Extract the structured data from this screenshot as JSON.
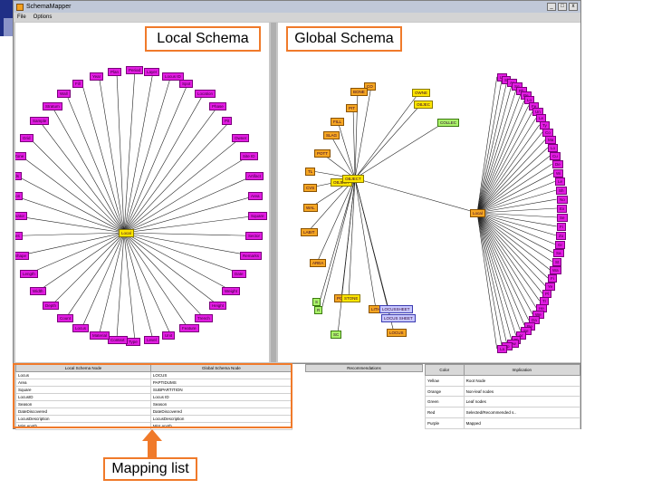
{
  "window": {
    "title": "SchemaMapper",
    "min": "_",
    "max": "□",
    "close": "x"
  },
  "menu": [
    "File",
    "Options"
  ],
  "callouts": {
    "local": "Local Schema",
    "global": "Global Schema",
    "mapping": "Mapping list"
  },
  "local_graph": {
    "center": "Local",
    "nodes": [
      "Period",
      "Layer",
      "Locus ID",
      "Spot",
      "Location",
      "Phase",
      "Pit",
      "Owner",
      "Site ID",
      "Artifact",
      "Area",
      "Square",
      "Sector",
      "Remarks",
      "Date",
      "Weight",
      "Height",
      "Trench",
      "Feature",
      "Unit",
      "Level",
      "Type",
      "Context",
      "Material",
      "Locus",
      "Count",
      "Depth",
      "Width",
      "Length",
      "Shape",
      "Notes",
      "Excavator",
      "Season",
      "Finds",
      "Zone",
      "Grid",
      "Sample",
      "Stratum",
      "Wall",
      "Fill",
      "Year",
      "Plan"
    ]
  },
  "global_graph": {
    "object_label": "OBJECT",
    "hub_label": "Local",
    "orange_nodes": [
      "CO",
      "BONE",
      "PIT",
      "FILL",
      "SLAG",
      "POTT",
      "TL",
      "CVS",
      "WAL",
      "LABIT",
      "AREA",
      "POTTERY",
      "LITHICS",
      "LOCUS"
    ],
    "yellow_nodes": [
      "OWNE",
      "OBJEC",
      "OBJECT",
      "STONE"
    ],
    "green_nodes": [
      "COLLEC",
      "S",
      "R",
      "SC"
    ],
    "purple_nodes": [
      "LOCUSSHEET",
      "LOCUS SHEET"
    ],
    "arc_nodes": [
      "Lo",
      "Si",
      "Ar",
      "Sq",
      "Ph",
      "Pe",
      "Lo",
      "Fe",
      "Un",
      "Le",
      "Ty",
      "Co",
      "Ma",
      "Lo",
      "Cu",
      "De",
      "Wi",
      "Le",
      "Sh",
      "No",
      "Ex",
      "Se",
      "Fi",
      "Zo",
      "Gr",
      "Sa",
      "St",
      "Wa",
      "Fi",
      "Ye",
      "Pl",
      "Tr",
      "He",
      "We",
      "Da",
      "Re",
      "Se",
      "Ar",
      "Pi",
      "Ow",
      "Sp",
      "La"
    ]
  },
  "mapping_table": {
    "headers": [
      "Local Schema Node",
      "Global Schema Node"
    ],
    "rows": [
      [
        "Locus",
        "LOCUS"
      ],
      [
        "Area",
        "PAPTIDUMS"
      ],
      [
        "Square",
        "SUBPARTITION"
      ],
      [
        "LocusID",
        "Locus ID"
      ],
      [
        "Season",
        "Season"
      ],
      [
        "DateDiscovered",
        "DateDiscovered"
      ],
      [
        "LocusDescription",
        "LocusDescription"
      ],
      [
        "MinLength",
        "MinLength"
      ]
    ]
  },
  "recommend_table": {
    "headers": [
      "Recommendations"
    ]
  },
  "legend_table": {
    "headers": [
      "Color",
      "Implication"
    ],
    "rows": [
      [
        "Yellow",
        "Root Node"
      ],
      [
        "Orange",
        "Non-leaf nodes"
      ],
      [
        "Green",
        "Leaf nodes"
      ],
      [
        "Red",
        "Selected/Recommended s.."
      ],
      [
        "Purple",
        "Mapped"
      ]
    ]
  },
  "colors": {
    "local": "#e21ce2",
    "orange": "#f5a623",
    "yellow": "#ffe600",
    "green": "#aaf26a",
    "purple": "#c8c8ff",
    "accent": "#f07a2a"
  }
}
